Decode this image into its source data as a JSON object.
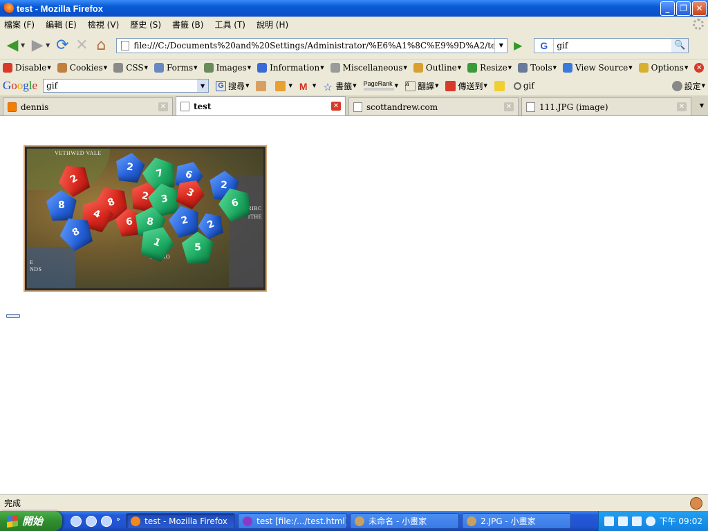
{
  "window": {
    "title": "test - Mozilla Firefox",
    "controls": [
      "_",
      "❐",
      "✕"
    ]
  },
  "menubar": {
    "items": [
      "檔案 (F)",
      "編輯 (E)",
      "檢視 (V)",
      "歷史 (S)",
      "書籤 (B)",
      "工具 (T)",
      "說明 (H)"
    ]
  },
  "navbar": {
    "back_icon": "◀",
    "forward_icon": "▶",
    "reload_icon": "⟳",
    "stop_icon": "✕",
    "home_icon": "⌂",
    "url": "file:///C:/Documents%20and%20Settings/Administrator/%E6%A1%8C%E9%9D%A2/test.html",
    "go_icon": "▶",
    "search_engine": "G",
    "search_value": "gif",
    "search_icon": "🔍"
  },
  "devbar": {
    "items": [
      {
        "label": "Disable",
        "icon": "disable-icon",
        "color": "#d83a2a"
      },
      {
        "label": "Cookies",
        "icon": "cookies-icon",
        "color": "#c08040"
      },
      {
        "label": "CSS",
        "icon": "css-icon",
        "color": "#8a8a8a"
      },
      {
        "label": "Forms",
        "icon": "forms-icon",
        "color": "#6a88c0"
      },
      {
        "label": "Images",
        "icon": "images-icon",
        "color": "#6a8a5a"
      },
      {
        "label": "Information",
        "icon": "information-icon",
        "color": "#3a6ad8"
      },
      {
        "label": "Miscellaneous",
        "icon": "miscellaneous-icon",
        "color": "#9a9a9a"
      },
      {
        "label": "Outline",
        "icon": "outline-icon",
        "color": "#d8a030"
      },
      {
        "label": "Resize",
        "icon": "resize-icon",
        "color": "#3a9a3a"
      },
      {
        "label": "Tools",
        "icon": "tools-icon",
        "color": "#6a7a9a"
      },
      {
        "label": "View Source",
        "icon": "view-source-icon",
        "color": "#3a7ad8"
      },
      {
        "label": "Options",
        "icon": "options-icon",
        "color": "#d8b030"
      }
    ],
    "status_icons": [
      {
        "name": "errors-icon",
        "glyph": "✕",
        "color": "#d83a2a"
      },
      {
        "name": "valid-icon",
        "glyph": "✓",
        "color": "#3aa83a"
      },
      {
        "name": "warning-icon",
        "glyph": "!",
        "color": "#e87020"
      }
    ]
  },
  "googlebar": {
    "logo": [
      "G",
      "o",
      "o",
      "g",
      "l",
      "e"
    ],
    "search_value": "gif",
    "search_label": "搜尋",
    "bookmarks_label": "書籤",
    "pagerank_label": "PageRank",
    "translate_label": "翻譯",
    "send_to_label": "傳送到",
    "highlight_query": "gif",
    "settings_label": "設定"
  },
  "tabs": [
    {
      "title": "dennis",
      "active": false,
      "icon": "blogger"
    },
    {
      "title": "test",
      "active": true,
      "icon": "page"
    },
    {
      "title": "scottandrew.com",
      "active": false,
      "icon": "page"
    },
    {
      "title": "111.JPG (image)",
      "active": false,
      "icon": "page"
    }
  ],
  "page": {
    "image_labels": [
      "VETHWED VALE",
      "SORRO",
      "RIRC",
      "ITHE",
      "E",
      "NDS"
    ],
    "dice_numbers": [
      "2",
      "2",
      "7",
      "6",
      "8",
      "8",
      "2",
      "3",
      "3",
      "2",
      "6",
      "4",
      "6",
      "8",
      "8",
      "2",
      "1",
      "5",
      "2"
    ]
  },
  "status": {
    "text": "完成"
  },
  "taskbar": {
    "start_label": "開始",
    "tasks": [
      {
        "label": "test - Mozilla Firefox",
        "active": true,
        "color": "#f08a20"
      },
      {
        "label": "test [file:/.../test.html] -...",
        "active": false,
        "color": "#8a3ac8"
      },
      {
        "label": "未命名 - 小畫家",
        "active": false,
        "color": "#c8a060"
      },
      {
        "label": "2.JPG - 小畫家",
        "active": false,
        "color": "#c8a060"
      }
    ],
    "clock": "下午 09:02"
  },
  "colors": {
    "titlebar": "#0a5ad6",
    "chrome": "#ece9d8",
    "taskbar": "#245ad8",
    "start": "#2f8f2f"
  }
}
